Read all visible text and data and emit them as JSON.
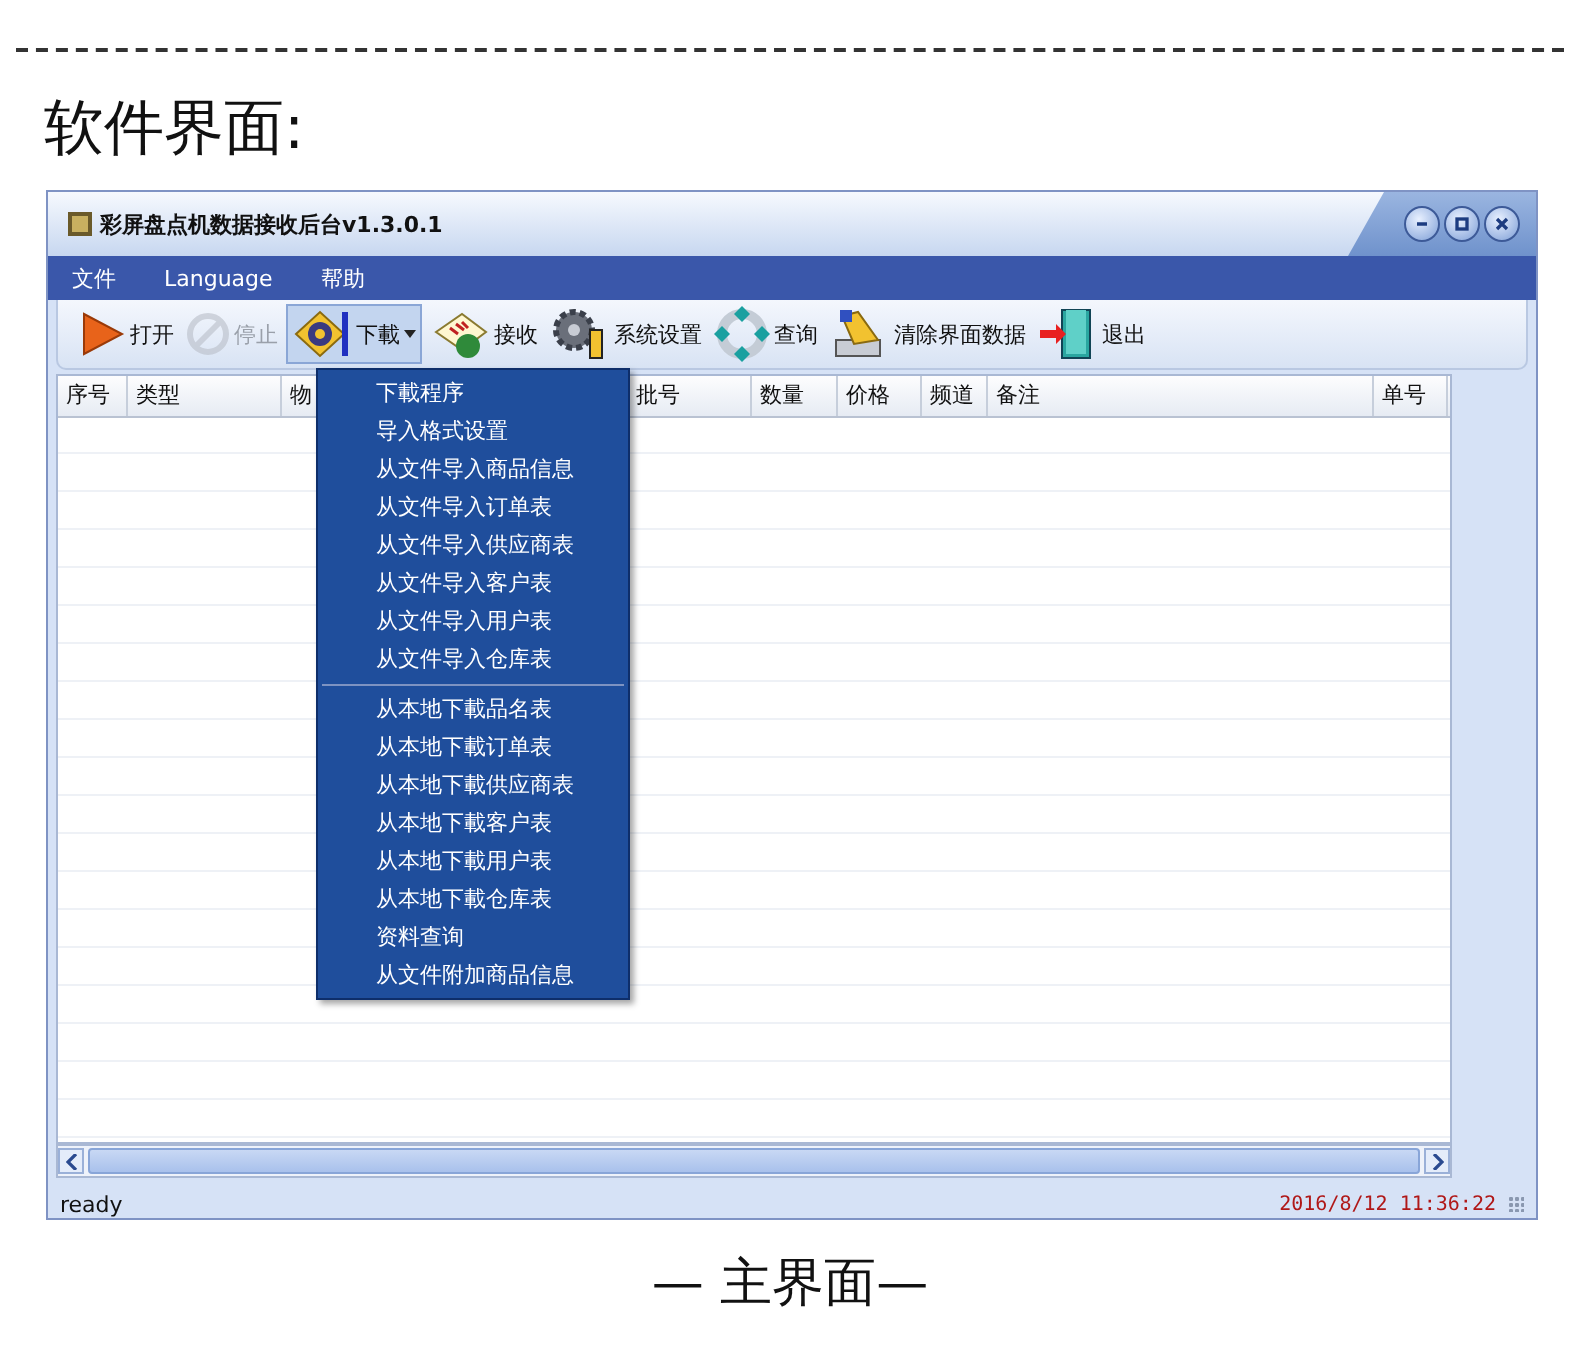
{
  "document": {
    "heading": "软件界面:",
    "caption": "— 主界面—"
  },
  "window": {
    "title": "彩屏盘点机数据接收后台v1.3.0.1"
  },
  "menu_bar": [
    "文件",
    "Language",
    "帮助"
  ],
  "toolbar": [
    {
      "kind": "open",
      "label": "打开",
      "disabled": false
    },
    {
      "kind": "stop",
      "label": "停止",
      "disabled": true
    },
    {
      "kind": "download",
      "label": "下載",
      "disabled": false,
      "expanded": true
    },
    {
      "kind": "receive",
      "label": "接收",
      "disabled": false
    },
    {
      "kind": "settings",
      "label": "系统设置",
      "disabled": false
    },
    {
      "kind": "query",
      "label": "查询",
      "disabled": false
    },
    {
      "kind": "clear",
      "label": "清除界面数据",
      "disabled": false
    },
    {
      "kind": "exit",
      "label": "退出",
      "disabled": false
    }
  ],
  "table": {
    "columns": [
      "序号",
      "类型",
      "物",
      "批号",
      "数量",
      "价格",
      "频道",
      "备注",
      "单号"
    ]
  },
  "dropdown_menu": {
    "sections": [
      [
        "下載程序",
        "导入格式设置",
        "从文件导入商品信息",
        "从文件导入订单表",
        "从文件导入供应商表",
        "从文件导入客户表",
        "从文件导入用户表",
        "从文件导入仓库表"
      ],
      [
        "从本地下載品名表",
        "从本地下載订单表",
        "从本地下載供应商表",
        "从本地下載客户表",
        "从本地下載用户表",
        "从本地下載仓库表",
        "资料查询",
        "从文件附加商品信息"
      ]
    ]
  },
  "status_bar": {
    "message": "ready",
    "timestamp": "2016/8/12 11:36:22"
  }
}
